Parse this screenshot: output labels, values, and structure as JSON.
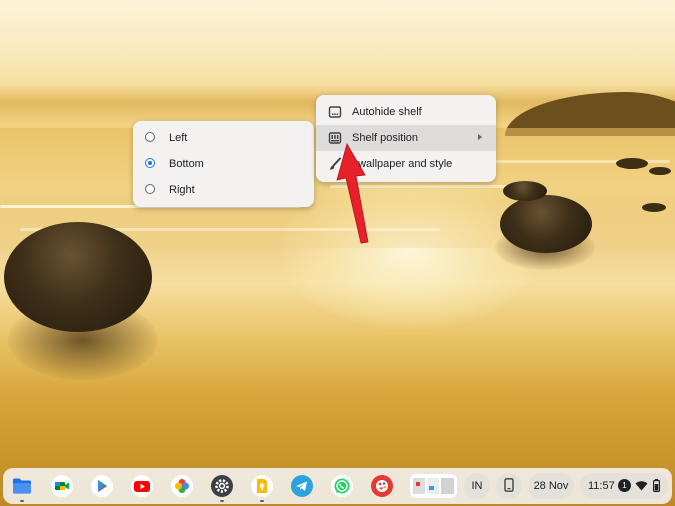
{
  "wallpaper_menu": {
    "items": [
      {
        "icon": "autohide-shelf-icon",
        "label": "Autohide shelf"
      },
      {
        "icon": "shelf-position-icon",
        "label": "Shelf position",
        "highlighted": true,
        "has_submenu": true
      },
      {
        "icon": "paintbrush-icon",
        "label": "t wallpaper and style"
      }
    ]
  },
  "shelf_position_submenu": {
    "options": [
      {
        "label": "Left",
        "selected": false
      },
      {
        "label": "Bottom",
        "selected": true
      },
      {
        "label": "Right",
        "selected": false
      }
    ]
  },
  "shelf": {
    "apps": [
      {
        "name": "Files",
        "icon": "files-icon"
      },
      {
        "name": "Google Meet",
        "icon": "meet-icon"
      },
      {
        "name": "Play Store",
        "icon": "play-store-icon"
      },
      {
        "name": "YouTube",
        "icon": "youtube-icon"
      },
      {
        "name": "Google Photos",
        "icon": "photos-icon"
      },
      {
        "name": "Settings",
        "icon": "settings-icon"
      },
      {
        "name": "Google Keep",
        "icon": "keep-icon"
      },
      {
        "name": "Telegram",
        "icon": "telegram-icon"
      },
      {
        "name": "WhatsApp",
        "icon": "whatsapp-icon"
      },
      {
        "name": "Chrome Canvas",
        "icon": "canvas-icon"
      }
    ],
    "tray": {
      "input_method": "IN",
      "date": "28 Nov",
      "time": "11:57",
      "notification_count": "1"
    }
  },
  "colors": {
    "accent": "#1a73e8",
    "annotation_arrow": "#e8202a",
    "menu_bg": "#f3f2f1",
    "menu_highlight": "#dedcdb"
  }
}
